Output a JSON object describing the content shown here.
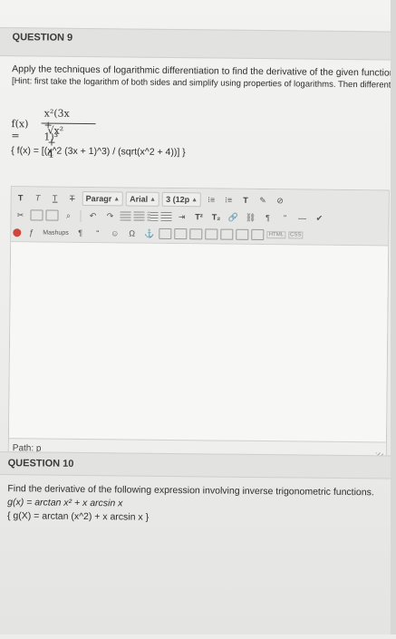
{
  "q9": {
    "title": "QUESTION 9",
    "prompt_line1": "Apply the techniques of logarithmic differentiation to find the derivative of the given function f(x).",
    "prompt_line2": "[Hint: first take the logarithm of both sides and simplify using properties of logarithms. Then differentiate implicitly.]",
    "formula_lhs": "f(x) =",
    "formula_num": "x²(3x + 1)³",
    "formula_den": "√x² + 4",
    "answer_text": "{ f(x) = [(x^2 (3x + 1)^3) / (sqrt(x^2 + 4))] }"
  },
  "toolbar": {
    "row1": [
      "T",
      "T",
      "T",
      "T"
    ],
    "paragraph": "Paragr",
    "font": "Arial",
    "size": "3 (12p",
    "list1": "⁝≡",
    "list2": "⁝≡",
    "text_color": "T",
    "row2_sup": "T²",
    "row2_sub": "T₂",
    "mashups": "Mashups",
    "html_tag": "HTML",
    "css_tag": "CSS"
  },
  "editor": {
    "path_label": "Path: p"
  },
  "q10": {
    "title": "QUESTION 10",
    "prompt": "Find the derivative of the following expression involving inverse trigonometric functions.",
    "expr": "g(x) = arctan x² + x arcsin x",
    "answer_text": "{ g(X) = arctan (x^2) + x arcsin x }"
  }
}
